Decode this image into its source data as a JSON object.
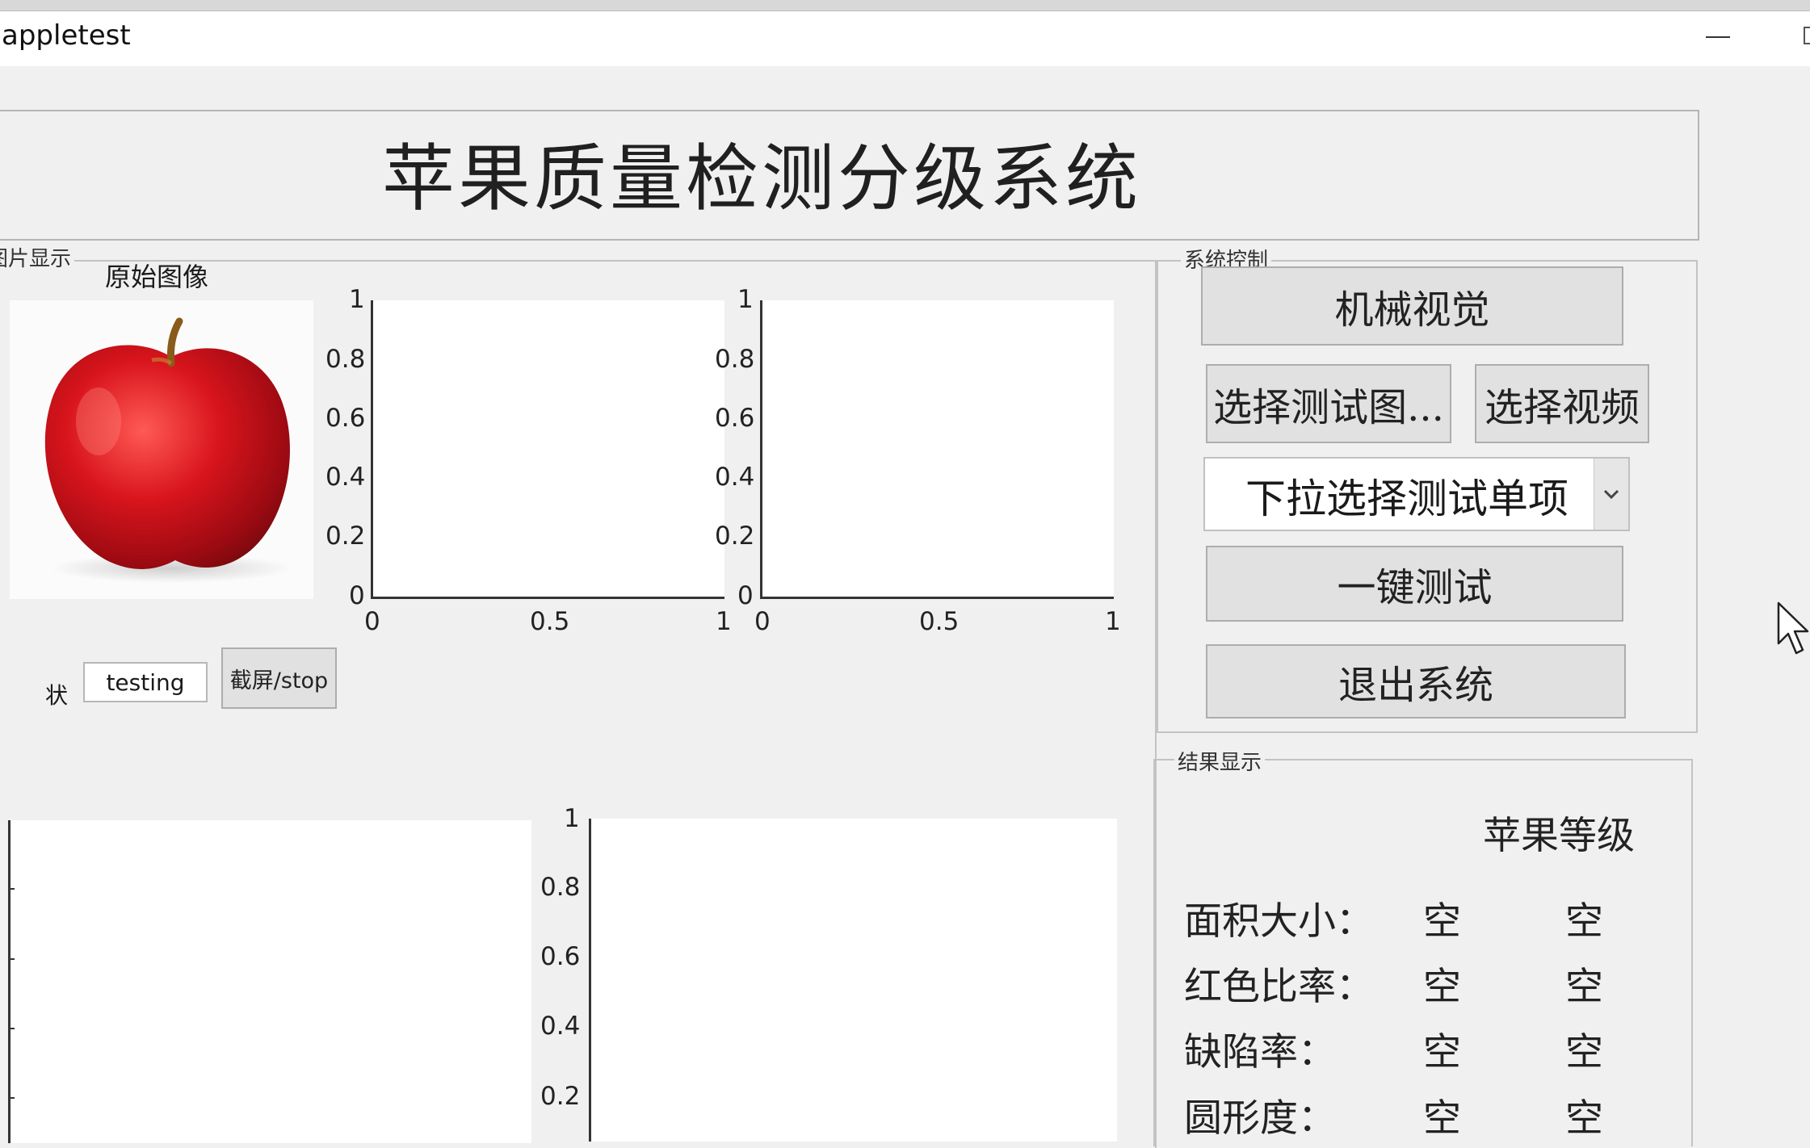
{
  "window": {
    "title": "appletest"
  },
  "heading": "苹果质量检测分级系统",
  "image_panel": {
    "label": "图片显示",
    "original_label": "原始图像",
    "status_label": "状",
    "status_value": "testing",
    "screenshot_button": "截屏/stop"
  },
  "axes": {
    "y_ticks": [
      "1",
      "0.8",
      "0.6",
      "0.4",
      "0.2",
      "0"
    ],
    "x_ticks": [
      "0",
      "0.5",
      "1"
    ],
    "lower_y_ticks": [
      "1",
      "0.8",
      "0.6",
      "0.4",
      "0.2"
    ]
  },
  "control": {
    "label": "系统控制",
    "machine_vision": "机械视觉",
    "select_image": "选择测试图...",
    "select_video": "选择视频",
    "dropdown_value": "下拉选择测试单项",
    "one_click_test": "一键测试",
    "exit": "退出系统"
  },
  "result": {
    "label": "结果显示",
    "grade_title": "苹果等级",
    "rows": [
      {
        "label": "面积大小：",
        "v1": "空",
        "v2": "空"
      },
      {
        "label": "红色比率：",
        "v1": "空",
        "v2": "空"
      },
      {
        "label": "缺陷率：",
        "v1": "空",
        "v2": "空"
      },
      {
        "label": "圆形度：",
        "v1": "空",
        "v2": "空"
      }
    ]
  },
  "colors": {
    "background": "#f0f0f0",
    "button": "#e1e1e1",
    "apple": "#c8141e"
  }
}
